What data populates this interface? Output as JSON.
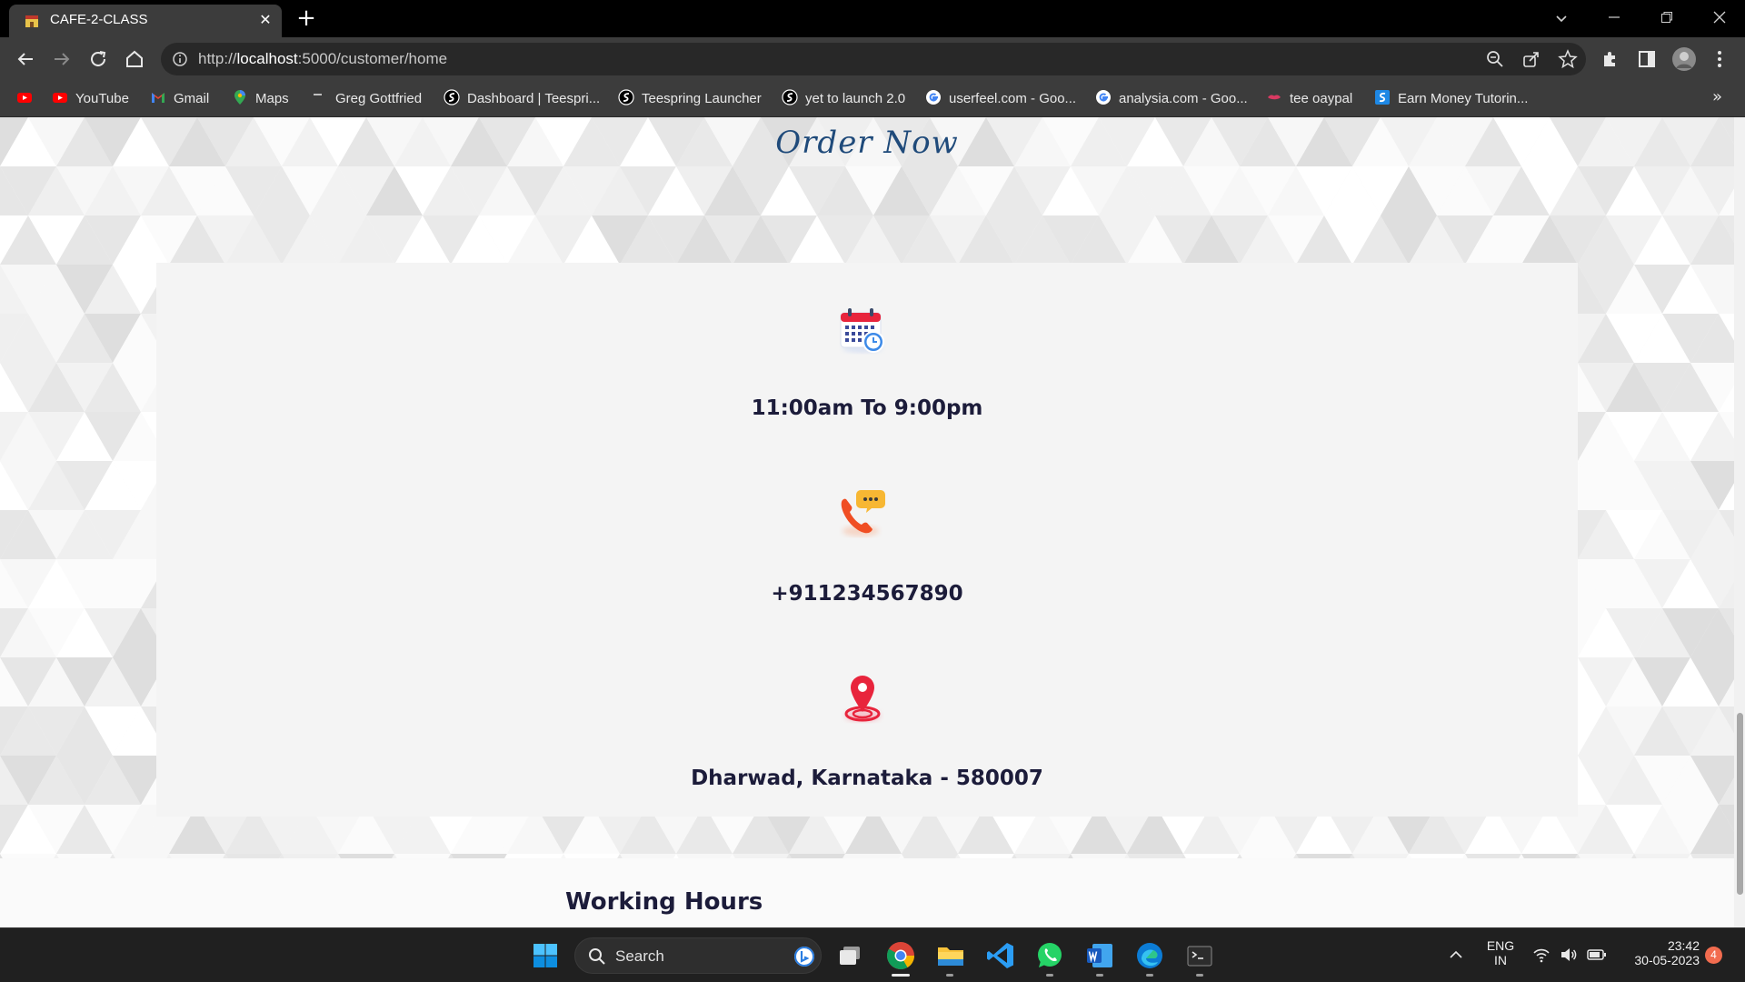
{
  "browser": {
    "tab_title": "CAFE-2-CLASS",
    "tab_close": "✕",
    "new_tab": "+",
    "url_scheme": "http://",
    "url_host": "localhost",
    "url_path": ":5000/customer/home"
  },
  "bookmarks": [
    {
      "label": "",
      "icon": "youtube-icon"
    },
    {
      "label": "YouTube",
      "icon": "youtube-icon"
    },
    {
      "label": "Gmail",
      "icon": "gmail-icon"
    },
    {
      "label": "Maps",
      "icon": "maps-icon"
    },
    {
      "label": "Greg Gottfried",
      "icon": "dash-icon"
    },
    {
      "label": "Dashboard | Teespri...",
      "icon": "teespring-icon"
    },
    {
      "label": "Teespring Launcher",
      "icon": "teespring-icon"
    },
    {
      "label": "yet to launch 2.0",
      "icon": "teespring-icon"
    },
    {
      "label": "userfeel.com - Goo...",
      "icon": "google-icon"
    },
    {
      "label": "analysia.com - Goo...",
      "icon": "google-icon"
    },
    {
      "label": "tee oaypal",
      "icon": "lips-icon"
    },
    {
      "label": "Earn Money Tutorin...",
      "icon": "s-icon"
    }
  ],
  "bookmarks_more": "»",
  "page": {
    "order_title": "Order Now",
    "hours": "11:00am To 9:00pm",
    "phone": "+911234567890",
    "address": "Dharwad, Karnataka - 580007",
    "working_hours_title": "Working Hours"
  },
  "taskbar": {
    "search_label": "Search",
    "lang_top": "ENG",
    "lang_bottom": "IN",
    "time": "23:42",
    "date": "30-05-2023",
    "notification_count": "4"
  },
  "colors": {
    "accent_red": "#e8243c",
    "title_blue": "#1f4a7a",
    "text_dark": "#1c1c3a"
  }
}
